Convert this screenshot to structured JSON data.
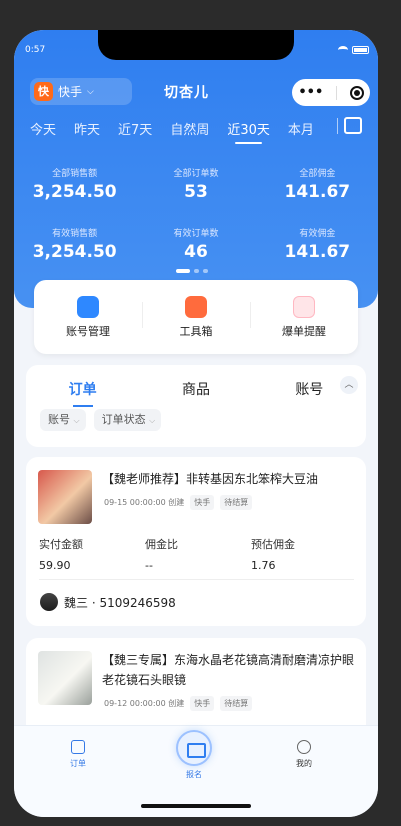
{
  "status": {
    "time": "0:57"
  },
  "header": {
    "platform": "快手",
    "platform_badge": "快",
    "platform_caret": "⌵",
    "brand": "切杏儿",
    "menu_icon": "•••"
  },
  "date_tabs": [
    {
      "label": "今天"
    },
    {
      "label": "昨天"
    },
    {
      "label": "近7天"
    },
    {
      "label": "自然周"
    },
    {
      "label": "近30天",
      "active": true
    },
    {
      "label": "本月"
    }
  ],
  "stats": {
    "row1": [
      {
        "label": "全部销售额",
        "value": "3,254.50"
      },
      {
        "label": "全部订单数",
        "value": "53"
      },
      {
        "label": "全部佣金",
        "value": "141.67"
      }
    ],
    "row2": [
      {
        "label": "有效销售额",
        "value": "3,254.50"
      },
      {
        "label": "有效订单数",
        "value": "46"
      },
      {
        "label": "有效佣金",
        "value": "141.67"
      }
    ]
  },
  "tools": [
    {
      "label": "账号管理",
      "icon": "account-icon"
    },
    {
      "label": "工具箱",
      "icon": "toolbox-icon"
    },
    {
      "label": "爆单提醒",
      "icon": "bell-icon"
    }
  ],
  "main_tabs": [
    {
      "label": "订单",
      "active": true
    },
    {
      "label": "商品"
    },
    {
      "label": "账号"
    }
  ],
  "filters": [
    {
      "label": "账号",
      "caret": "⌵"
    },
    {
      "label": "订单状态",
      "caret": "⌵"
    }
  ],
  "orders": [
    {
      "title": "【魏老师推荐】非转基因东北笨榨大豆油",
      "time": "09-15 00:00:00 创建",
      "platform": "快手",
      "status": "待结算",
      "metrics": [
        {
          "label": "实付金额",
          "value": "59.90"
        },
        {
          "label": "佣金比",
          "value": "--"
        },
        {
          "label": "预估佣金",
          "value": "1.76"
        }
      ],
      "user": "魏三 · 5109246598"
    },
    {
      "title": "【魏三专属】东海水晶老花镜高清耐磨清凉护眼老花镜石头眼镜",
      "time": "09-12 00:00:00 创建",
      "platform": "快手",
      "status": "待结算"
    }
  ],
  "bottom_nav": [
    {
      "label": "订单",
      "icon": "order-icon"
    },
    {
      "label": "报名",
      "icon": "signup-icon"
    },
    {
      "label": "我的",
      "icon": "profile-icon"
    }
  ]
}
